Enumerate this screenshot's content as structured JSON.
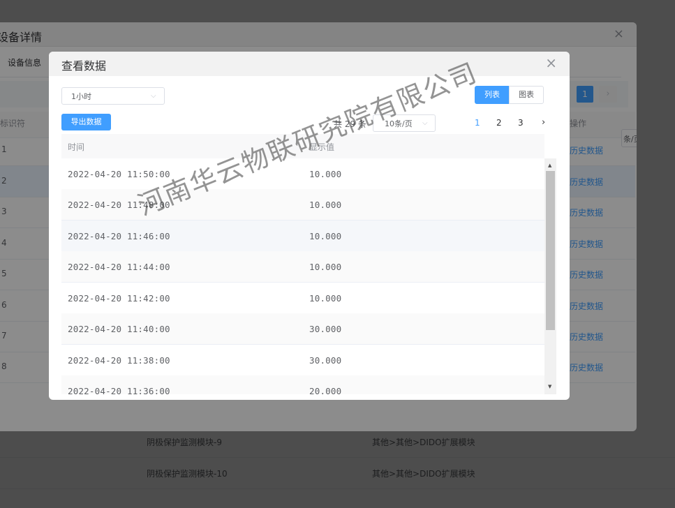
{
  "background": {
    "rows": [
      {
        "name": "阴极保护监测模块-9",
        "type": "其他>其他>DIDO扩展模块"
      },
      {
        "name": "阴极保护监测模块-10",
        "type": "其他>其他>DIDO扩展模块"
      }
    ]
  },
  "device_dialog": {
    "title": "设备详情",
    "close_icon": "×",
    "tab": "设备信息",
    "page_active": "1",
    "page_next": "›",
    "col_identifier": "标识符",
    "col_action": "操作",
    "page_size": "条/页",
    "rows": [
      {
        "num": "1",
        "link": "历史数据"
      },
      {
        "num": "2",
        "link": "历史数据"
      },
      {
        "num": "3",
        "link": "历史数据"
      },
      {
        "num": "4",
        "link": "历史数据"
      },
      {
        "num": "5",
        "link": "历史数据"
      },
      {
        "num": "6",
        "link": "历史数据"
      },
      {
        "num": "7",
        "link": "历史数据"
      },
      {
        "num": "8",
        "link": "历史数据"
      }
    ]
  },
  "data_dialog": {
    "title": "查看数据",
    "close_icon": "×",
    "time_select": "1小时",
    "view_list": "列表",
    "view_chart": "图表",
    "export_button": "导出数据",
    "pagination": {
      "total": "共 29 条",
      "page_size": "10条/页",
      "pages": [
        "1",
        "2",
        "3"
      ],
      "active_page": "1",
      "next": "›"
    },
    "table": {
      "headers": [
        "时间",
        "显示值"
      ],
      "rows": [
        [
          "2022-04-20 11:50:00",
          "10.000"
        ],
        [
          "2022-04-20 11:48:00",
          "10.000"
        ],
        [
          "2022-04-20 11:46:00",
          "10.000"
        ],
        [
          "2022-04-20 11:44:00",
          "10.000"
        ],
        [
          "2022-04-20 11:42:00",
          "10.000"
        ],
        [
          "2022-04-20 11:40:00",
          "30.000"
        ],
        [
          "2022-04-20 11:38:00",
          "30.000"
        ],
        [
          "2022-04-20 11:36:00",
          "20.000"
        ]
      ]
    }
  },
  "watermark": "河南华云物联研究院有限公司",
  "colors": {
    "accent": "#409eff",
    "link": "#409eff",
    "header_bg": "#f2f2f2"
  }
}
